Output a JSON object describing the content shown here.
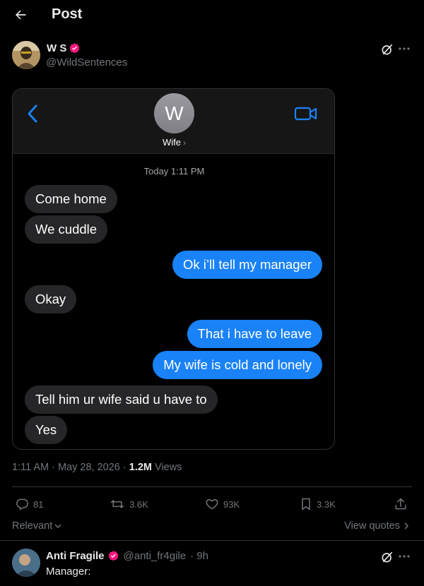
{
  "header": {
    "title": "Post"
  },
  "post": {
    "author_name": "W S",
    "handle": "@WildSentences",
    "posted_at": "1:11 AM · May 28, 2026",
    "separator": " · ",
    "views_count": "1.2M",
    "views_label": "Views"
  },
  "imessage": {
    "contact_initial": "W",
    "contact_name": "Wife",
    "timestamp": "Today 1:11 PM",
    "messages": [
      {
        "text": "Come home",
        "direction": "incoming"
      },
      {
        "text": "We cuddle",
        "direction": "incoming"
      },
      {
        "text": "Ok i’ll tell my manager",
        "direction": "outgoing"
      },
      {
        "text": "Okay",
        "direction": "incoming"
      },
      {
        "text": "That i have to leave",
        "direction": "outgoing"
      },
      {
        "text": "My wife is cold and lonely",
        "direction": "outgoing"
      },
      {
        "text": "Tell him ur wife said u have to",
        "direction": "incoming"
      },
      {
        "text": "Yes",
        "direction": "incoming"
      }
    ],
    "colors": {
      "incoming": "#262628",
      "outgoing": "#1a82f7",
      "accent": "#1a82f7"
    }
  },
  "actions": {
    "replies": "81",
    "reposts": "3.6K",
    "likes": "93K",
    "bookmarks": "3.3K"
  },
  "sort": {
    "label": "Relevant"
  },
  "quotes": {
    "label": "View quotes"
  },
  "reply": {
    "name": "Anti Fragile",
    "handle": "@anti_fr4gile",
    "time": "· 9h",
    "text": "Manager:"
  },
  "icons": [
    "back-arrow-icon",
    "verified-badge-icon",
    "grok-icon",
    "more-icon",
    "imessage-back-icon",
    "facetime-icon",
    "reply-icon",
    "repost-icon",
    "like-icon",
    "bookmark-icon",
    "share-icon",
    "chevron-down-icon",
    "chevron-right-icon"
  ],
  "theme": {
    "background": "#000000",
    "text": "#e7e9ea",
    "muted": "#71767b",
    "verified": "#f91880"
  }
}
